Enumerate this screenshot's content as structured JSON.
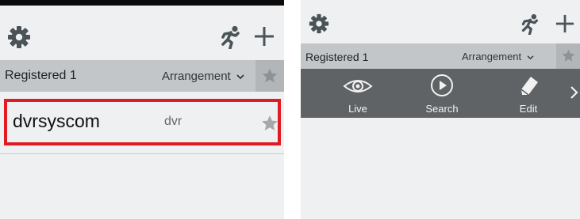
{
  "left_panel": {
    "segment": {
      "filter_label": "Registered 1",
      "arrangement_label": "Arrangement",
      "arrangement_icon": "chevron-down-icon",
      "favorite_icon": "star-icon"
    },
    "device": {
      "name": "dvrsyscom",
      "type": "dvr",
      "favorite_icon": "star-icon",
      "highlight_color": "#e01b24"
    },
    "toolbar": {
      "settings_icon": "gear-icon",
      "emergency_icon": "running-person-icon",
      "add_icon": "plus-icon"
    }
  },
  "right_panel": {
    "segment": {
      "filter_label": "Registered 1",
      "arrangement_label": "Arrangement",
      "arrangement_icon": "chevron-down-icon",
      "favorite_icon": "star-icon"
    },
    "toolbar": {
      "settings_icon": "gear-icon",
      "emergency_icon": "running-person-icon",
      "add_icon": "plus-icon"
    },
    "actions": [
      {
        "label": "Live",
        "icon": "eye-icon"
      },
      {
        "label": "Search",
        "icon": "play-circle-icon"
      },
      {
        "label": "Edit",
        "icon": "eraser-icon"
      }
    ],
    "more_icon": "chevron-right-icon"
  },
  "colors": {
    "background": "#eef0f1",
    "segment_bar": "#c3c6c9",
    "action_bar": "#5f6366",
    "icon_dark": "#4a5458",
    "highlight": "#e01b24"
  }
}
